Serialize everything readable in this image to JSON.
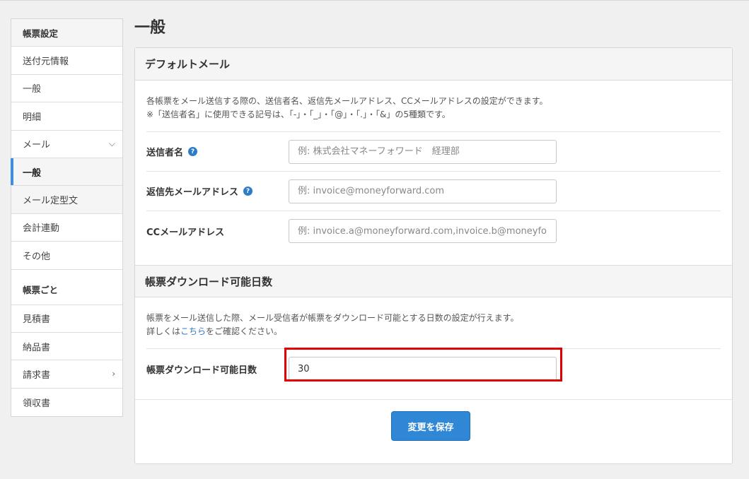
{
  "sidebar": {
    "group1_title": "帳票設定",
    "items1": [
      "送付元情報",
      "一般",
      "明細",
      "メール"
    ],
    "sub_items": [
      "一般",
      "メール定型文"
    ],
    "items2": [
      "会計連動",
      "その他"
    ],
    "group2_title": "帳票ごと",
    "items3": [
      "見積書",
      "納品書",
      "請求書",
      "領収書"
    ]
  },
  "page_title": "一般",
  "default_mail": {
    "heading": "デフォルトメール",
    "desc_line1": "各帳票をメール送信する際の、送信者名、返信先メールアドレス、CCメールアドレスの設定ができます。",
    "desc_line2": "※「送信者名」に使用できる記号は、「-」・「_」・「@」・「.」・「&」の5種類です。",
    "sender_label": "送信者名",
    "sender_placeholder": "例: 株式会社マネーフォワード　経理部",
    "reply_label": "返信先メールアドレス",
    "reply_placeholder": "例: invoice@moneyforward.com",
    "cc_label": "CCメールアドレス",
    "cc_placeholder": "例: invoice.a@moneyforward.com,invoice.b@moneyforward.com"
  },
  "download": {
    "heading": "帳票ダウンロード可能日数",
    "desc_line1": "帳票をメール送信した際、メール受信者が帳票をダウンロード可能とする日数の設定が行えます。",
    "desc_line2_pre": "詳しくは",
    "desc_link": "こちら",
    "desc_line2_post": "をご確認ください。",
    "days_label": "帳票ダウンロード可能日数",
    "days_value": "30"
  },
  "save_button": "変更を保存",
  "help_icon_char": "?"
}
